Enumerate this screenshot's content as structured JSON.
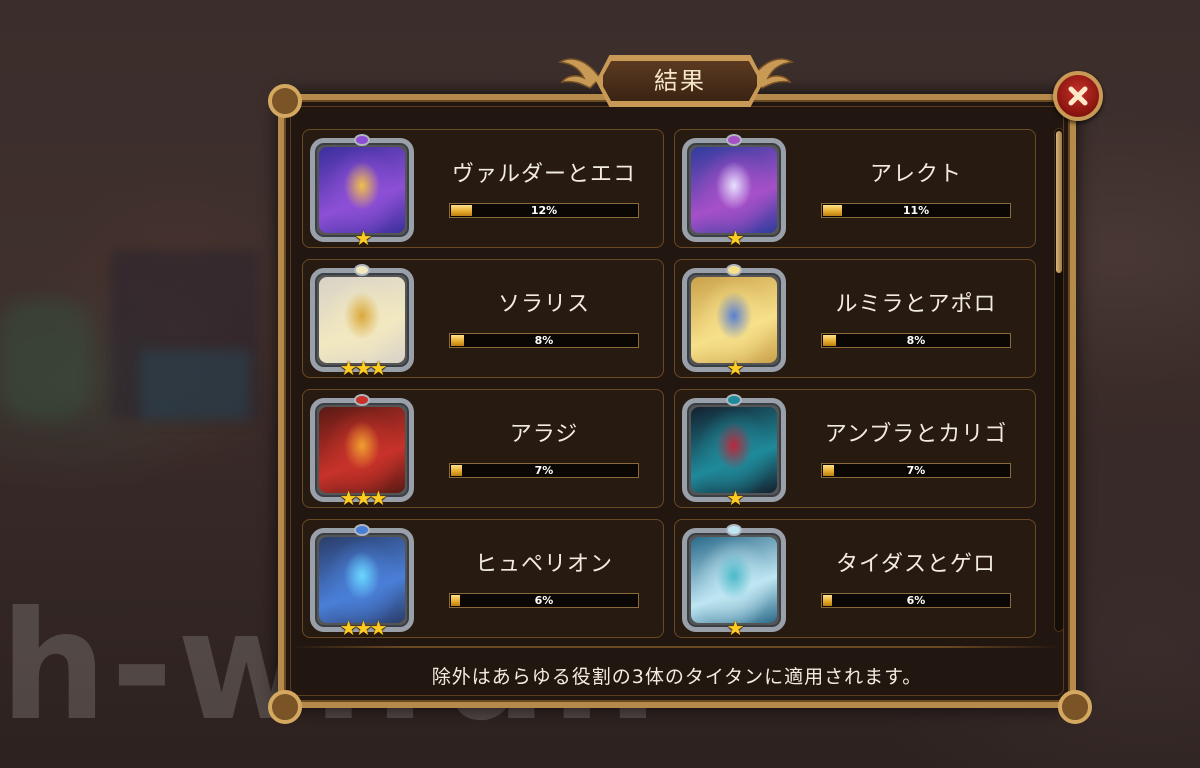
{
  "dialog": {
    "title": "結果",
    "footer_note": "除外はあらゆる役割の3体のタイタンに適用されます。",
    "watermark": "h-w.fun"
  },
  "titans": [
    {
      "name": "ヴァルダーとエコ",
      "percent_label": "12%",
      "percent": 12,
      "stars": 1,
      "art_colors": [
        "#3b2f9c",
        "#8d4fd6",
        "#f0c04a"
      ]
    },
    {
      "name": "アレクト",
      "percent_label": "11%",
      "percent": 11,
      "stars": 1,
      "art_colors": [
        "#2e3c9c",
        "#a650c8",
        "#e8e0ff"
      ]
    },
    {
      "name": "ソラリス",
      "percent_label": "8%",
      "percent": 8,
      "stars": 3,
      "art_colors": [
        "#d8d2c8",
        "#f2e8c0",
        "#d9a83a"
      ]
    },
    {
      "name": "ルミラとアポロ",
      "percent_label": "8%",
      "percent": 8,
      "stars": 1,
      "art_colors": [
        "#caa24a",
        "#f7e08a",
        "#5a7fd0"
      ]
    },
    {
      "name": "アラジ",
      "percent_label": "7%",
      "percent": 7,
      "stars": 3,
      "art_colors": [
        "#5a1a14",
        "#c8322a",
        "#f0a030"
      ]
    },
    {
      "name": "アンブラとカリゴ",
      "percent_label": "7%",
      "percent": 7,
      "stars": 1,
      "art_colors": [
        "#14202e",
        "#1f8a9a",
        "#b8283a"
      ]
    },
    {
      "name": "ヒュペリオン",
      "percent_label": "6%",
      "percent": 6,
      "stars": 3,
      "art_colors": [
        "#2a3d6a",
        "#4a7fd8",
        "#6ad8ff"
      ]
    },
    {
      "name": "タイダスとゲロ",
      "percent_label": "6%",
      "percent": 6,
      "stars": 1,
      "art_colors": [
        "#2a6a8a",
        "#bfe6f2",
        "#4ab8c8"
      ]
    }
  ],
  "icons": {
    "close": "close-x-icon",
    "star": "★"
  }
}
